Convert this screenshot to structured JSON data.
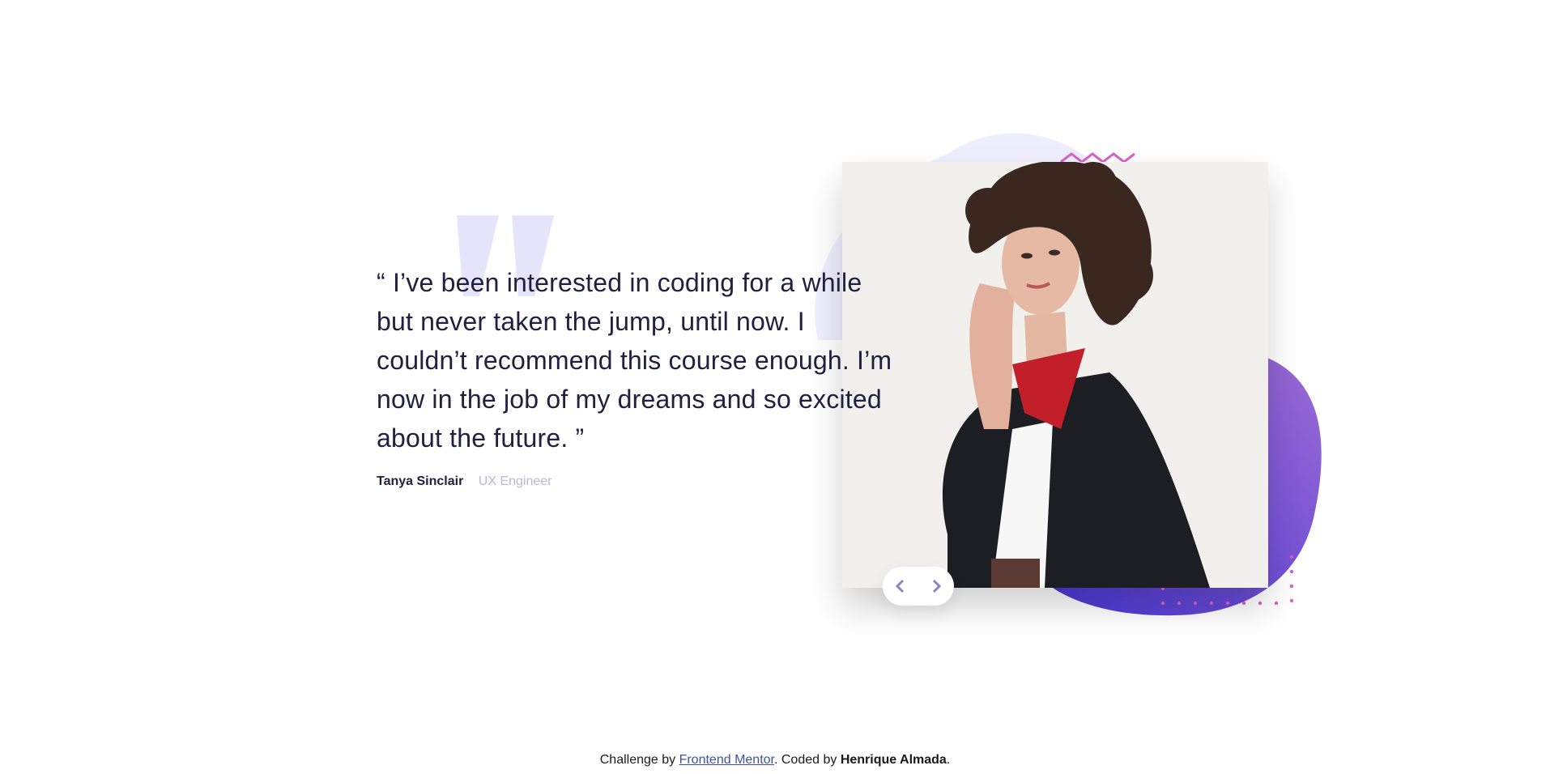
{
  "testimonial": {
    "quote": "“ I’ve been interested in coding for a while but never taken the jump, until now. I couldn’t recommend this course enough. I’m now in the job of my dreams and so excited about the future. ”",
    "author_name": "Tanya Sinclair",
    "author_role": "UX Engineer"
  },
  "navigation": {
    "prev_icon": "chevron-left-icon",
    "next_icon": "chevron-right-icon"
  },
  "footer": {
    "prefix": "Challenge by ",
    "link_text": "Frontend Mentor",
    "middle": ". Coded by ",
    "author": "Henrique Almada",
    "suffix": "."
  },
  "colors": {
    "dark_navy": "#202040",
    "muted_role": "#b8b8d8",
    "quote_mark": "#e6e4fb",
    "blob_purple": "#6a4fd8",
    "accent_pink": "#d563c9",
    "link_blue": "#3e52a3"
  }
}
